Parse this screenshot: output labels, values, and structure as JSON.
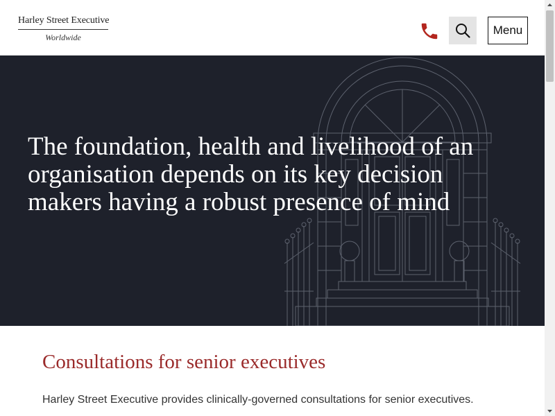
{
  "header": {
    "logo_line1": "Harley Street Executive",
    "logo_line2": "Worldwide",
    "menu_label": "Menu",
    "phone_icon": "phone-icon",
    "search_icon": "search-icon"
  },
  "hero": {
    "heading": "The foundation, health and livelihood of an organisation depends on its key decision makers having a robust presence of mind"
  },
  "content": {
    "title": "Consultations for senior executives",
    "body": "Harley Street Executive provides clinically-governed consultations for senior executives."
  },
  "colors": {
    "hero_bg": "#1e212b",
    "accent_red": "#9a2a2a",
    "phone_red": "#b3261e",
    "search_bg": "#e4e4e4"
  }
}
